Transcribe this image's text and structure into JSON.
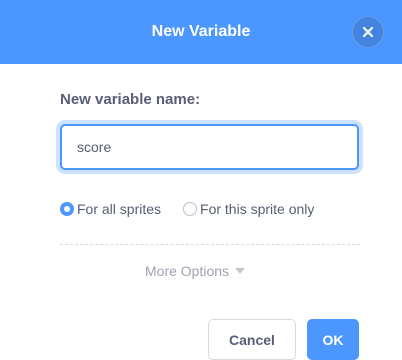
{
  "dialog": {
    "title": "New Variable",
    "close_icon": "close-icon"
  },
  "form": {
    "name_label": "New variable name:",
    "name_value": "score",
    "scope_options": [
      {
        "label": "For all sprites",
        "selected": true
      },
      {
        "label": "For this sprite only",
        "selected": false
      }
    ],
    "more_options_label": "More Options"
  },
  "buttons": {
    "cancel_label": "Cancel",
    "ok_label": "OK"
  },
  "colors": {
    "accent": "#4c97ff",
    "text": "#575e75",
    "muted_text": "#9ea3b0"
  }
}
